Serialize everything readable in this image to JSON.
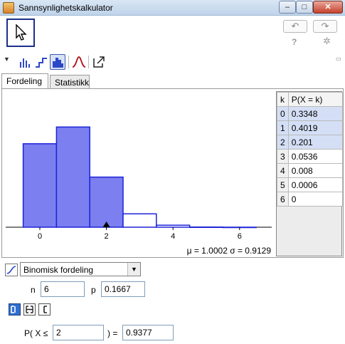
{
  "window": {
    "title": "Sannsynlighetskalkulator"
  },
  "toolbar": {
    "help_label": "?"
  },
  "tabs": [
    {
      "label": "Fordeling"
    },
    {
      "label": "Statistikk"
    }
  ],
  "chart_data": {
    "type": "bar",
    "categories": [
      "0",
      "1",
      "2",
      "3",
      "4",
      "5",
      "6"
    ],
    "values": [
      0.3348,
      0.4019,
      0.201,
      0.0536,
      0.008,
      0.0006,
      0
    ],
    "highlighted": [
      0,
      1,
      2
    ],
    "xticks": [
      "0",
      "2",
      "4",
      "6"
    ],
    "marker_at": 2,
    "summary": "μ = 1.0002   σ = 0.9129",
    "ylim": [
      0,
      0.46
    ]
  },
  "table": {
    "headers": [
      "k",
      "P(X = k)"
    ],
    "rows": [
      {
        "k": "0",
        "p": "0.3348"
      },
      {
        "k": "1",
        "p": "0.4019"
      },
      {
        "k": "2",
        "p": "0.201"
      },
      {
        "k": "3",
        "p": "0.0536"
      },
      {
        "k": "4",
        "p": "0.008"
      },
      {
        "k": "5",
        "p": "0.0006"
      },
      {
        "k": "6",
        "p": "0"
      }
    ]
  },
  "controls": {
    "distribution": "Binomisk fordeling",
    "n_label": "n",
    "n_value": "6",
    "p_label": "p",
    "p_value": "0.1667",
    "prob_prefix": "P( X ≤",
    "prob_mid": ") =",
    "bound_value": "2",
    "result_value": "0.9377"
  },
  "colors": {
    "highlight_fill": "#7b7ff0",
    "bar_stroke": "#1d24d8"
  }
}
